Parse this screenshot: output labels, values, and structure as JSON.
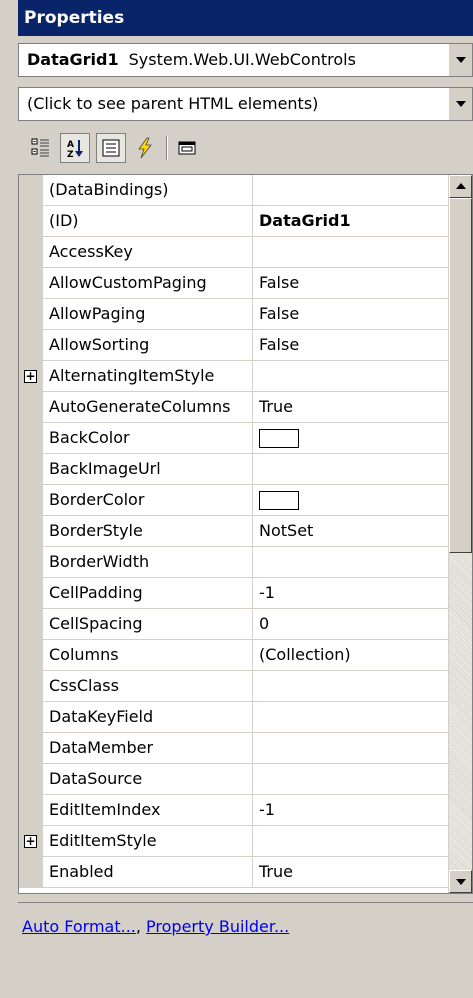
{
  "window": {
    "title": "Properties"
  },
  "object_selector": {
    "name": "DataGrid1",
    "type": "System.Web.UI.WebControls"
  },
  "parent_selector": {
    "text": "(Click to see parent HTML elements)"
  },
  "toolbar": {
    "buttons": [
      {
        "name": "categorized-icon",
        "pressed": false
      },
      {
        "name": "alphabetical-icon",
        "pressed": true
      },
      {
        "name": "properties-icon",
        "pressed": true
      },
      {
        "name": "events-icon",
        "pressed": false
      },
      {
        "name": "property-pages-icon",
        "pressed": false
      }
    ]
  },
  "properties": [
    {
      "name": "(DataBindings)",
      "value": ""
    },
    {
      "name": "(ID)",
      "value": "DataGrid1",
      "bold": true
    },
    {
      "name": "AccessKey",
      "value": ""
    },
    {
      "name": "AllowCustomPaging",
      "value": "False"
    },
    {
      "name": "AllowPaging",
      "value": "False"
    },
    {
      "name": "AllowSorting",
      "value": "False"
    },
    {
      "name": "AlternatingItemStyle",
      "value": "",
      "expandable": true
    },
    {
      "name": "AutoGenerateColumns",
      "value": "True"
    },
    {
      "name": "BackColor",
      "value": "",
      "swatch": "#ffffff"
    },
    {
      "name": "BackImageUrl",
      "value": ""
    },
    {
      "name": "BorderColor",
      "value": "",
      "swatch": "#ffffff"
    },
    {
      "name": "BorderStyle",
      "value": "NotSet"
    },
    {
      "name": "BorderWidth",
      "value": ""
    },
    {
      "name": "CellPadding",
      "value": "-1"
    },
    {
      "name": "CellSpacing",
      "value": "0"
    },
    {
      "name": "Columns",
      "value": "(Collection)"
    },
    {
      "name": "CssClass",
      "value": ""
    },
    {
      "name": "DataKeyField",
      "value": ""
    },
    {
      "name": "DataMember",
      "value": ""
    },
    {
      "name": "DataSource",
      "value": ""
    },
    {
      "name": "EditItemIndex",
      "value": "-1"
    },
    {
      "name": "EditItemStyle",
      "value": "",
      "expandable": true
    },
    {
      "name": "Enabled",
      "value": "True"
    }
  ],
  "verbs": {
    "auto_format": "Auto Format...",
    "separator": ", ",
    "property_builder": "Property Builder..."
  }
}
